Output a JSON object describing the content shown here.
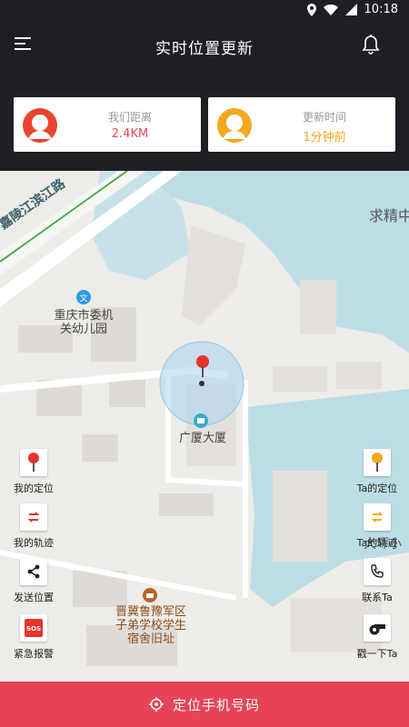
{
  "status_bar": {
    "time": "10:18"
  },
  "header": {
    "title": "实时位置更新"
  },
  "cards": {
    "distance": {
      "label": "我们距离",
      "value": "2.4KM",
      "color": "#e84a5a"
    },
    "update": {
      "label": "更新时间",
      "value": "1分钟前",
      "color": "#f2a91e"
    }
  },
  "map": {
    "labels": {
      "road": "嘉陵江滨江路",
      "kindergarten": "重庆市委机\n关幼儿园",
      "building": "广厦大厦",
      "camp": "晋冀鲁豫军区\n子弟学校学生\n宿舍旧址",
      "top_right": "求精中",
      "mid_right": "大坪小"
    }
  },
  "left_actions": [
    {
      "label": "我的定位",
      "icon": "pin-icon"
    },
    {
      "label": "我的轨迹",
      "icon": "track-icon"
    },
    {
      "label": "发送位置",
      "icon": "share-icon"
    },
    {
      "label": "紧急报警",
      "icon": "sos-icon"
    }
  ],
  "right_actions": [
    {
      "label": "Ta的定位",
      "icon": "pin-icon"
    },
    {
      "label": "Ta的轨迹",
      "icon": "track-icon"
    },
    {
      "label": "联系Ta",
      "icon": "phone-icon"
    },
    {
      "label": "戳一下Ta",
      "icon": "whistle-icon"
    }
  ],
  "bottom": {
    "label": "定位手机号码"
  },
  "colors": {
    "accent": "#e64456",
    "dark": "#1e1f24",
    "orange": "#f2a91e"
  }
}
